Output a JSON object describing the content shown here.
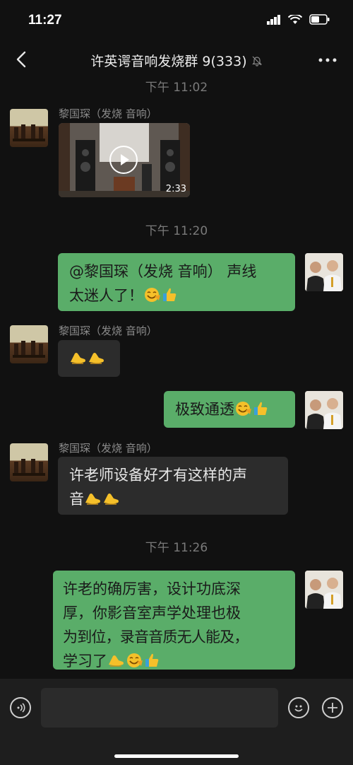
{
  "status": {
    "time": "11:27"
  },
  "header": {
    "title": "许英谔音响发烧群 9(333)"
  },
  "messages": {
    "t1": "下午 11:02",
    "sender_name": "黎国琛（发烧 音响）",
    "video_duration": "2:33",
    "t2": "下午 11:20",
    "m2_line1": "@黎国琛（发烧 音响） 声线",
    "m2_line2": "太迷人了！",
    "m4_text": "极致通透",
    "m5_line1": "许老师设备好才有这样的声",
    "m5_line2": "音",
    "t3": "下午 11:26",
    "m6_line1": "许老的确厉害，设计功底深",
    "m6_line2": "厚，你影音室声学处理也极",
    "m6_line3": "为到位，录音音质无人能及，",
    "m6_line4": "学习了"
  },
  "icons": {
    "back": "chevron-left-icon",
    "mute": "bell-slash-icon",
    "more": "more-dots-icon",
    "voice": "voice-icon",
    "emoji": "emoji-icon",
    "add": "plus-icon",
    "emoji_in_text": [
      "clap-icon",
      "smile-face-icon",
      "thumbs-up-icon"
    ]
  },
  "colors": {
    "outgoing_bubble": "#5aad69",
    "incoming_bubble": "#2c2c2c",
    "background": "#111111"
  }
}
